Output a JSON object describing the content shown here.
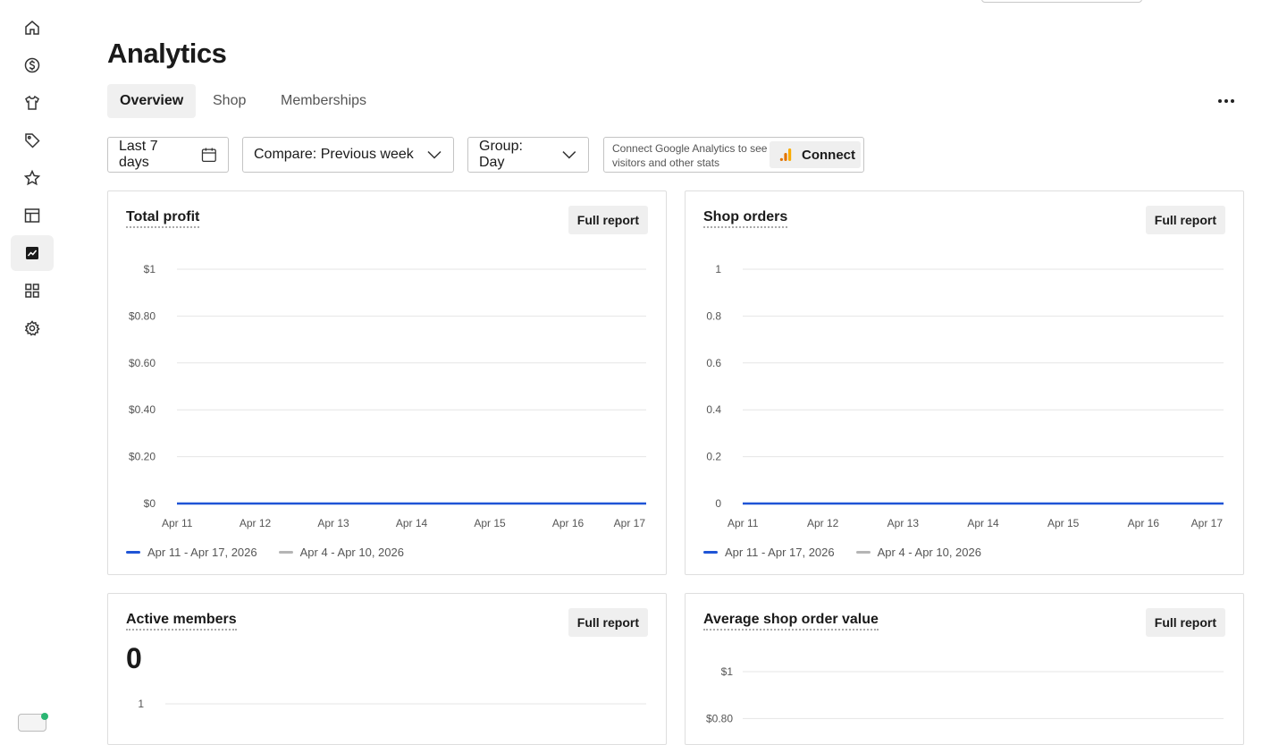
{
  "page": {
    "title": "Analytics"
  },
  "sidebar": {
    "items": [
      {
        "icon": "home-icon"
      },
      {
        "icon": "dollar-icon"
      },
      {
        "icon": "shirt-icon"
      },
      {
        "icon": "tag-icon"
      },
      {
        "icon": "star-icon"
      },
      {
        "icon": "layout-icon"
      },
      {
        "icon": "analytics-icon",
        "active": true
      },
      {
        "icon": "apps-icon"
      },
      {
        "icon": "settings-icon"
      }
    ]
  },
  "tabs": [
    {
      "label": "Overview",
      "active": true
    },
    {
      "label": "Shop"
    },
    {
      "label": "Memberships"
    }
  ],
  "filters": {
    "date_range": "Last 7 days",
    "compare": "Compare: Previous week",
    "group": "Group: Day"
  },
  "google_analytics": {
    "text": "Connect Google Analytics to see visitors and other stats",
    "button": "Connect"
  },
  "colors": {
    "current_series": "#1f54d6",
    "previous_series": "#b5b5b5",
    "grid": "#e6e6e6",
    "accent_dot": "#2bb673"
  },
  "cards": {
    "total_profit": {
      "title": "Total profit",
      "button": "Full report"
    },
    "shop_orders": {
      "title": "Shop orders",
      "button": "Full report"
    },
    "active_members": {
      "title": "Active members",
      "button": "Full report",
      "value": "0"
    },
    "avg_order_value": {
      "title": "Average shop order value",
      "button": "Full report"
    }
  },
  "legend": {
    "current": "Apr 11 - Apr 17, 2026",
    "previous": "Apr 4 - Apr 10, 2026"
  },
  "chart_data": [
    {
      "type": "line",
      "title": "Total profit",
      "categories": [
        "Apr 11",
        "Apr 12",
        "Apr 13",
        "Apr 14",
        "Apr 15",
        "Apr 16",
        "Apr 17"
      ],
      "y_ticks": [
        "$1",
        "$0.80",
        "$0.60",
        "$0.40",
        "$0.20",
        "$0"
      ],
      "ylim": [
        0,
        1
      ],
      "grid": true,
      "legend_position": "bottom-left",
      "series": [
        {
          "name": "Apr 11 - Apr 17, 2026",
          "values": [
            0,
            0,
            0,
            0,
            0,
            0,
            0
          ]
        }
      ]
    },
    {
      "type": "line",
      "title": "Shop orders",
      "categories": [
        "Apr 11",
        "Apr 12",
        "Apr 13",
        "Apr 14",
        "Apr 15",
        "Apr 16",
        "Apr 17"
      ],
      "y_ticks": [
        "1",
        "0.8",
        "0.6",
        "0.4",
        "0.2",
        "0"
      ],
      "ylim": [
        0,
        1
      ],
      "grid": true,
      "legend_position": "bottom-left",
      "series": [
        {
          "name": "Apr 11 - Apr 17, 2026",
          "values": [
            0,
            0,
            0,
            0,
            0,
            0,
            0
          ]
        }
      ]
    },
    {
      "type": "line",
      "title": "Active members",
      "y_ticks": [
        "1"
      ],
      "ylim": [
        0,
        1
      ],
      "grid": true
    },
    {
      "type": "line",
      "title": "Average shop order value",
      "y_ticks": [
        "$1",
        "$0.80"
      ],
      "ylim": [
        0,
        1
      ],
      "grid": true
    }
  ]
}
